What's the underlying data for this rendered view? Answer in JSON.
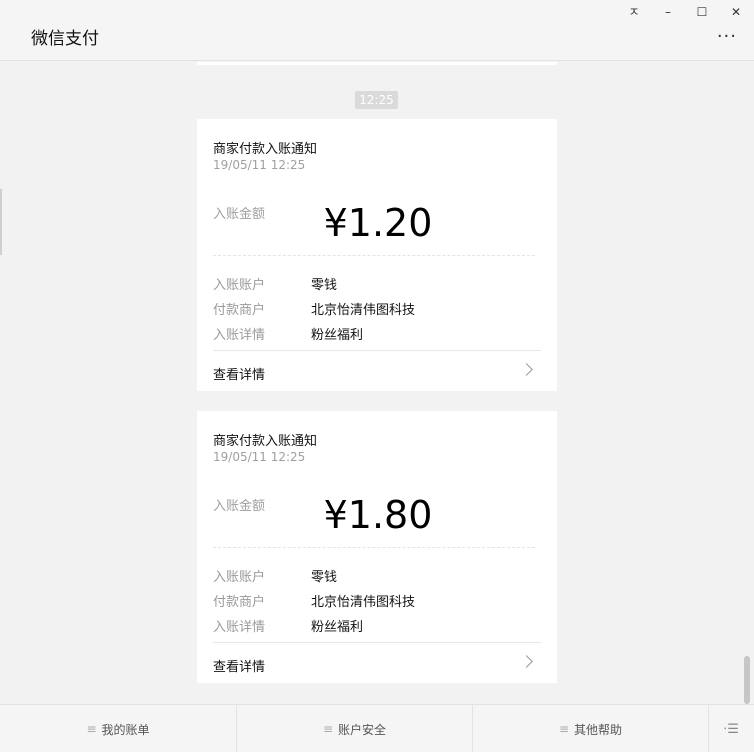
{
  "window": {
    "title": "微信支付",
    "controls": {
      "pin": "퓨",
      "minimize": "–",
      "maximize": "☐",
      "close": "✕"
    },
    "more": "···"
  },
  "timeline": {
    "time": "12:25"
  },
  "cards": [
    {
      "title": "商家付款入账通知",
      "date": "19/05/11 12:25",
      "amount_label": "入账金额",
      "amount": "¥1.20",
      "rows": [
        {
          "k": "入账账户",
          "v": "零钱"
        },
        {
          "k": "付款商户",
          "v": "北京怡清伟图科技"
        },
        {
          "k": "入账详情",
          "v": "粉丝福利"
        }
      ],
      "detail_label": "查看详情"
    },
    {
      "title": "商家付款入账通知",
      "date": "19/05/11 12:25",
      "amount_label": "入账金额",
      "amount": "¥1.80",
      "rows": [
        {
          "k": "入账账户",
          "v": "零钱"
        },
        {
          "k": "付款商户",
          "v": "北京怡清伟图科技"
        },
        {
          "k": "入账详情",
          "v": "粉丝福利"
        }
      ],
      "detail_label": "查看详情"
    }
  ],
  "footer": {
    "tabs": [
      {
        "label": "我的账单",
        "icon": "menu-icon"
      },
      {
        "label": "账户安全",
        "icon": "menu-icon"
      },
      {
        "label": "其他帮助",
        "icon": "menu-icon"
      }
    ],
    "collapse_icon": "collapse-menu-icon"
  }
}
